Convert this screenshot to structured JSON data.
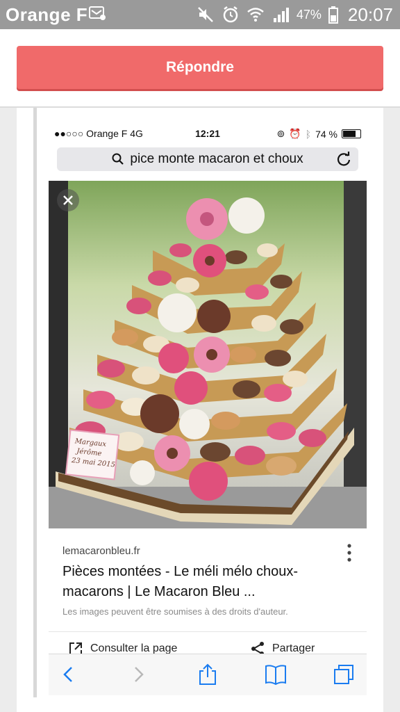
{
  "status_bar": {
    "carrier": "Orange F",
    "battery": "47%",
    "time": "20:07"
  },
  "header": {
    "reply_label": "Répondre"
  },
  "embedded_screenshot": {
    "status": {
      "carrier": "●●○○○ Orange F  4G",
      "time": "12:21",
      "battery": "74 %"
    },
    "search_query": "pice monte macaron et choux",
    "image_overlay_text": "Margaux\nJérôme\n23 mai 2015",
    "result": {
      "source": "lemacaronbleu.fr",
      "title": "Pièces montées - Le méli mélo choux-macarons | Le Macaron Bleu ...",
      "copyright_note": "Les images peuvent être soumises à des droits d'auteur.",
      "action_visit": "Consulter la page",
      "action_share": "Partager"
    }
  },
  "colors": {
    "accent": "#f06a6a",
    "status_bar": "#9a9a9a",
    "ios_blue": "#1a7cf0"
  }
}
